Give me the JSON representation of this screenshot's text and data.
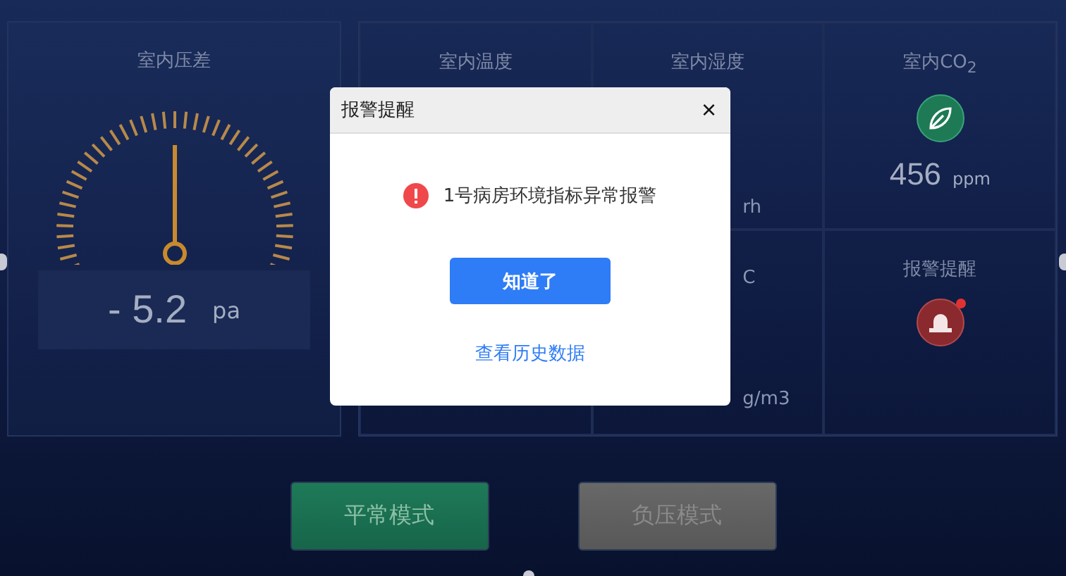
{
  "pressure_panel": {
    "title": "室内压差",
    "value": "- 5.2",
    "unit": "pa"
  },
  "cells": [
    {
      "kind": "title",
      "title": "室内温度"
    },
    {
      "kind": "peek",
      "title": "室内湿度",
      "value_fragment": "rh"
    },
    {
      "kind": "leaf",
      "title": "室内CO$_{2}$",
      "value": "456",
      "unit": "ppm"
    },
    {
      "kind": "hidden"
    },
    {
      "kind": "peek",
      "title_fragment": "C",
      "value_fragment": "g/m3"
    },
    {
      "kind": "alarm",
      "title": "报警提醒",
      "alert": true
    }
  ],
  "modes": [
    {
      "label": "平常模式",
      "selected": true
    },
    {
      "label": "负压模式",
      "selected": false
    }
  ],
  "dialog": {
    "title": "报警提醒",
    "close": "×",
    "message": "1号病房环境指标异常报警",
    "confirm": "知道了",
    "link": "查看历史数据"
  }
}
